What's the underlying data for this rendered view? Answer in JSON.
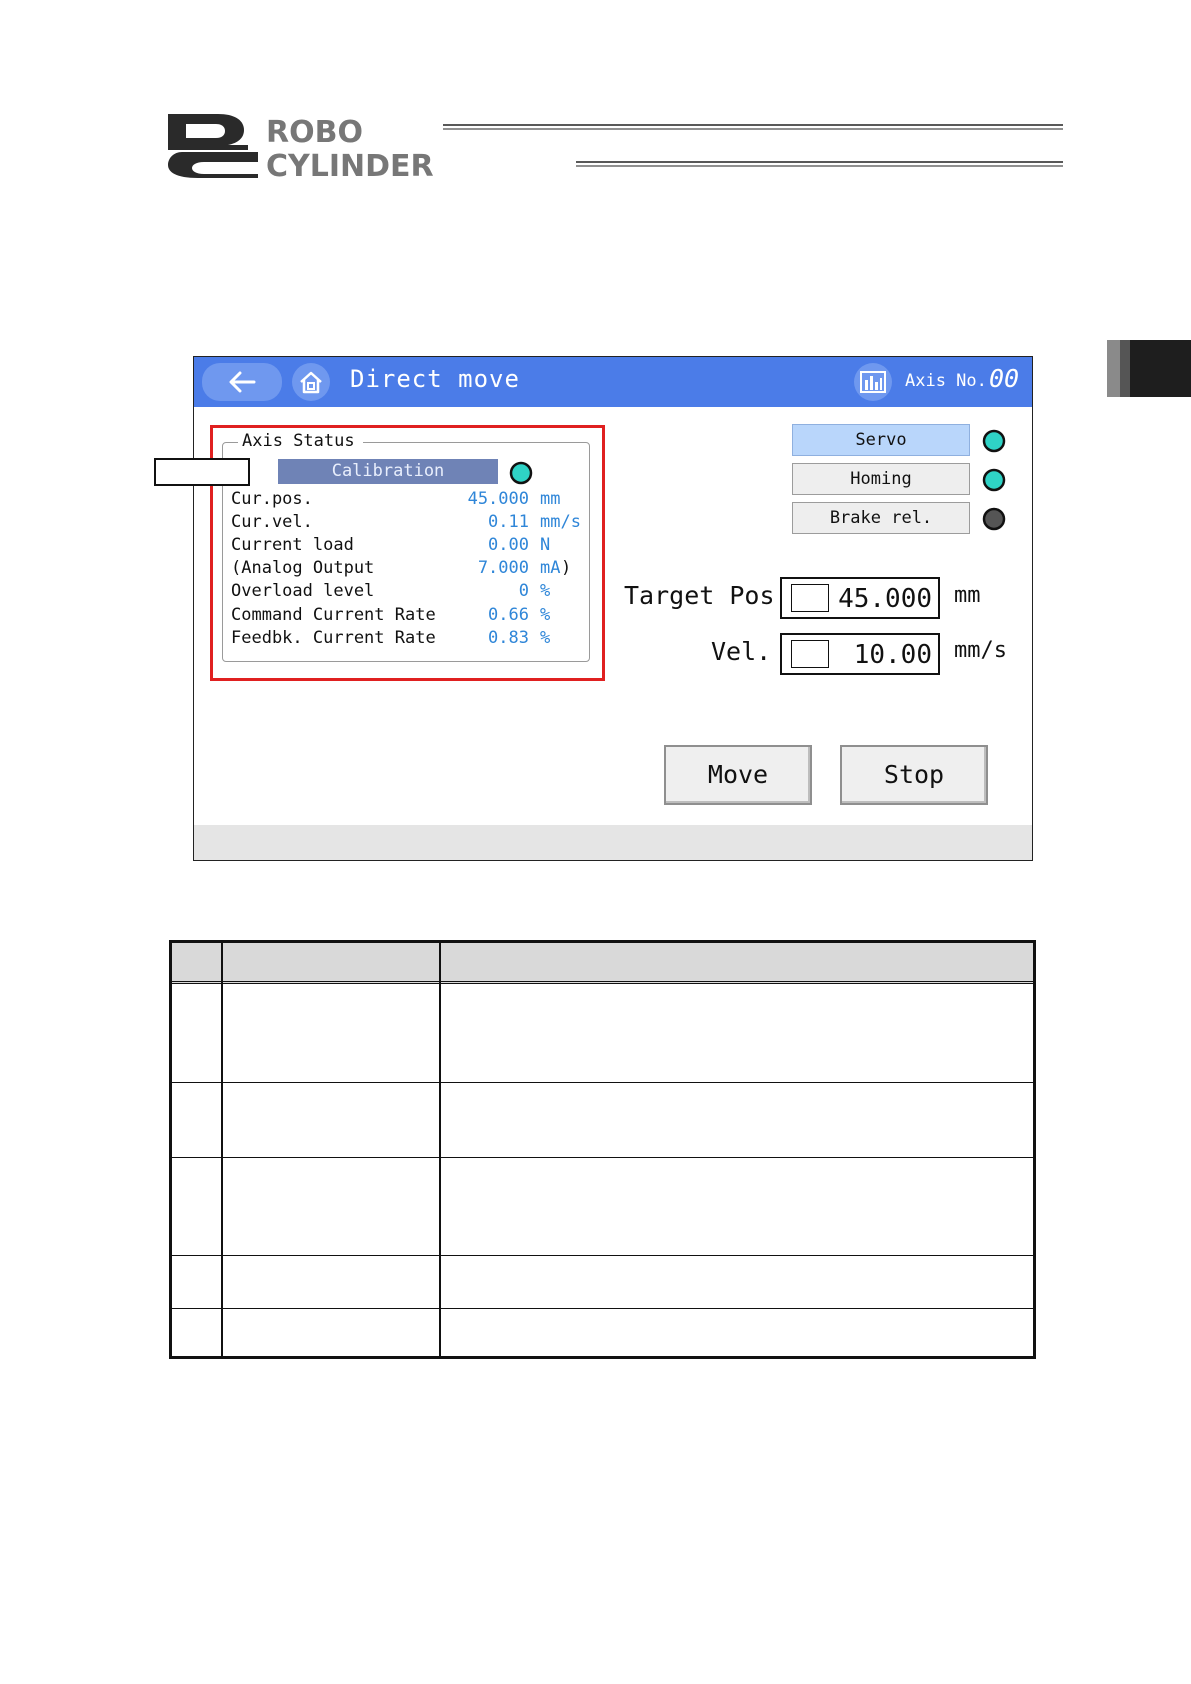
{
  "brand": {
    "logo_line1": "ROBO",
    "logo_line2": "CYLINDER"
  },
  "titlebar": {
    "screen_title": "Direct move",
    "axis_label": "Axis No.",
    "axis_value": "00"
  },
  "axis_status": {
    "legend": "Axis Status",
    "calibration_label": "Calibration",
    "calibration_led_color": "#2fd3c6",
    "rows": [
      {
        "label": "Cur.pos.",
        "value": "45.000",
        "unit": "mm"
      },
      {
        "label": "Cur.vel.",
        "value": "0.11",
        "unit": "mm/s"
      },
      {
        "label": "Current load",
        "value": "0.00",
        "unit": "N"
      },
      {
        "label": "(Analog Output",
        "value": "7.000",
        "unit": "mA",
        "suffix": ")"
      },
      {
        "label": "Overload level",
        "value": "0",
        "unit": "%"
      },
      {
        "label": "Command Current Rate",
        "value": "0.66",
        "unit": "%"
      },
      {
        "label": "Feedbk. Current Rate",
        "value": "0.83",
        "unit": "%"
      }
    ]
  },
  "controls": {
    "servo_label": "Servo",
    "servo_led_color": "#2fd3c6",
    "homing_label": "Homing",
    "homing_led_color": "#2fd3c6",
    "brake_label": "Brake rel.",
    "brake_led_color": "#555555",
    "target_label": "Target Pos.",
    "target_value": "45.000",
    "target_unit": "mm",
    "vel_label": "Vel.",
    "vel_value": "10.00",
    "vel_unit": "mm/s",
    "move_label": "Move",
    "stop_label": "Stop"
  },
  "colors": {
    "titlebar": "#4b7ce8",
    "highlight_border": "#e02020",
    "value_text": "#2f86d8"
  },
  "icons": [
    "back-arrow-icon",
    "home-icon",
    "graph-icon"
  ]
}
